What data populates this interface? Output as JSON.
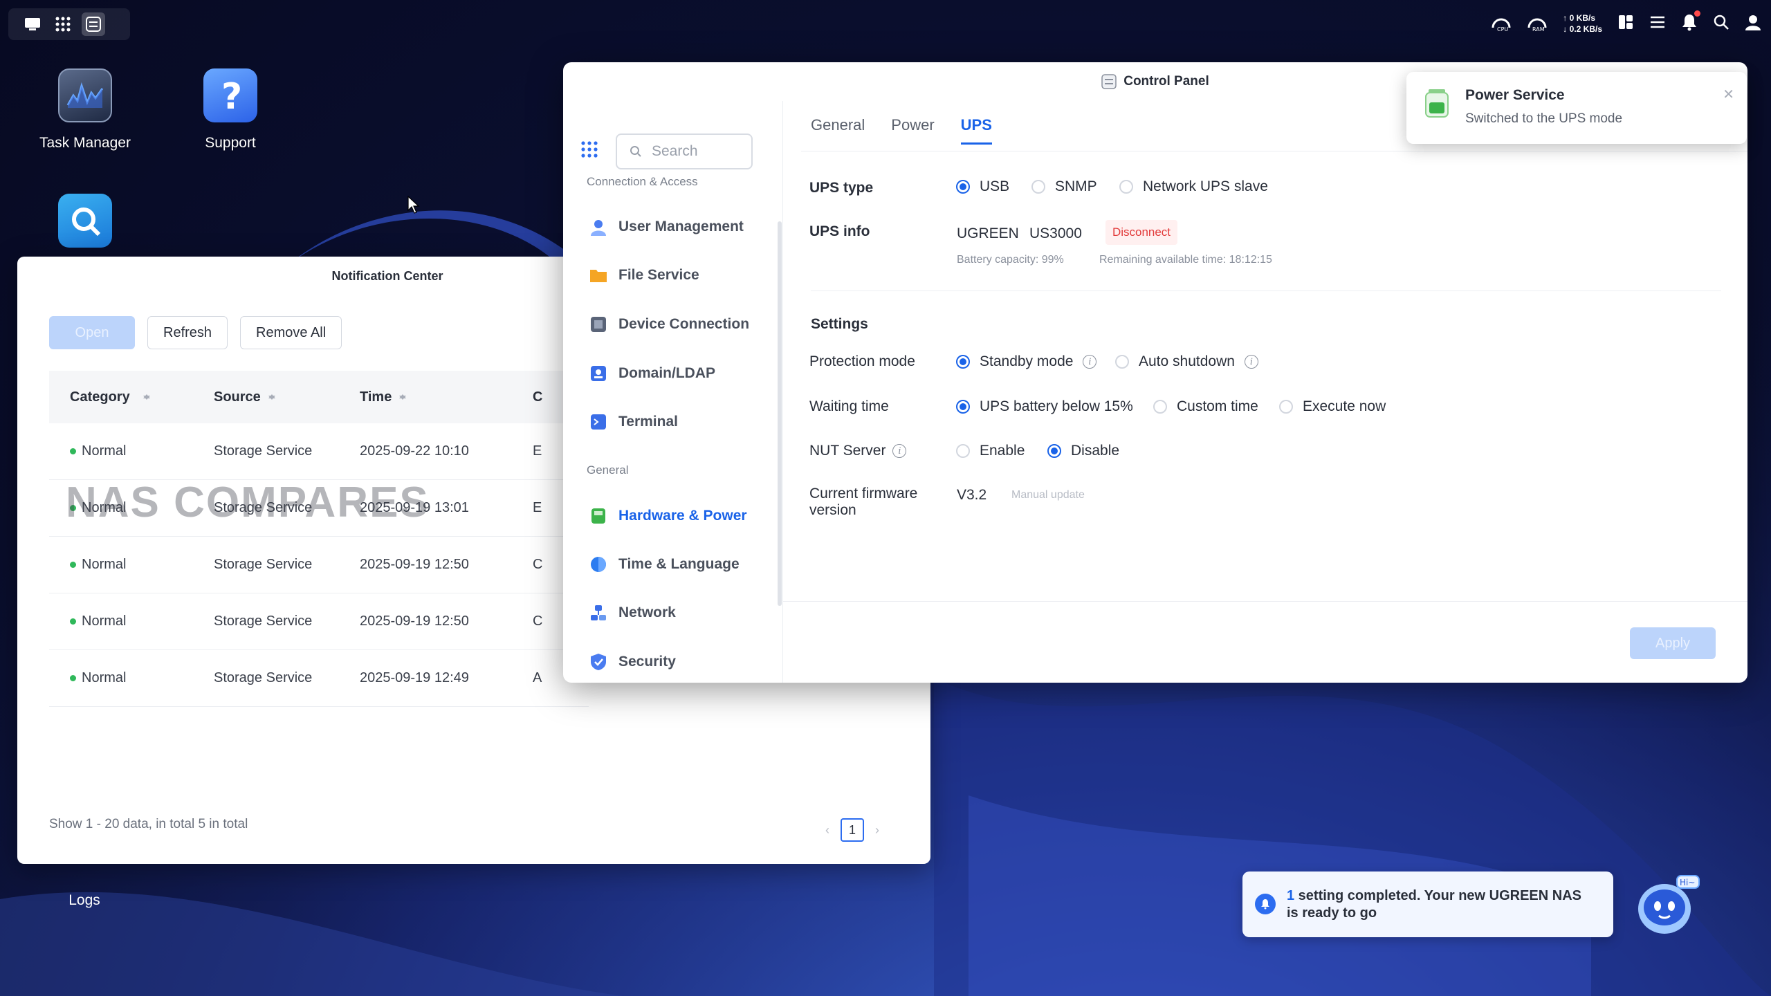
{
  "desktop": {
    "icons": [
      {
        "label": "Task Manager"
      },
      {
        "label": "Support"
      },
      {
        "label": "Logs"
      }
    ]
  },
  "topbar": {
    "net_up": "0 KB/s",
    "net_down": "0.2 KB/s",
    "icons": [
      "cpu-gauge-icon",
      "ram-gauge-icon",
      "widgets-icon",
      "task-list-icon",
      "bell-icon",
      "search-icon",
      "user-icon"
    ]
  },
  "notification_center": {
    "title": "Notification Center",
    "toolbar": {
      "open_label": "Open",
      "refresh_label": "Refresh",
      "remove_all_label": "Remove All"
    },
    "columns": [
      "Category",
      "Source",
      "Time",
      "C"
    ],
    "rows": [
      {
        "category": "Normal",
        "source": "Storage Service",
        "time": "2025-09-22 10:10",
        "content": "E"
      },
      {
        "category": "Normal",
        "source": "Storage Service",
        "time": "2025-09-19 13:01",
        "content": "E"
      },
      {
        "category": "Normal",
        "source": "Storage Service",
        "time": "2025-09-19 12:50",
        "content": "C"
      },
      {
        "category": "Normal",
        "source": "Storage Service",
        "time": "2025-09-19 12:50",
        "content": "C"
      },
      {
        "category": "Normal",
        "source": "Storage Service",
        "time": "2025-09-19 12:49",
        "content": "A"
      }
    ],
    "footer": "Show 1 - 20 data, in total 5 in total",
    "current_page": "1",
    "watermark": "NAS COMPARES"
  },
  "control_panel": {
    "title": "Control Panel",
    "search_placeholder": "Search",
    "groups": {
      "connection": "Connection & Access",
      "general": "General"
    },
    "sidebar": [
      {
        "label": "User Management",
        "color": "#4a7cf0"
      },
      {
        "label": "File Service",
        "color": "#f5a524"
      },
      {
        "label": "Device Connection",
        "color": "#5a6478"
      },
      {
        "label": "Domain/LDAP",
        "color": "#3a6ee8"
      },
      {
        "label": "Terminal",
        "color": "#3a6ee8"
      },
      {
        "label": "Hardware & Power",
        "color": "#3cb34a"
      },
      {
        "label": "Time & Language",
        "color": "#2c7cf0"
      },
      {
        "label": "Network",
        "color": "#3a6ee8"
      },
      {
        "label": "Security",
        "color": "#4a7cf0"
      }
    ],
    "tabs": [
      "General",
      "Power",
      "UPS"
    ],
    "active_tab": "UPS",
    "ups": {
      "type_label": "UPS type",
      "type_options": [
        "USB",
        "SNMP",
        "Network UPS slave"
      ],
      "type_selected": "USB",
      "info_label": "UPS info",
      "brand": "UGREEN",
      "model": "US3000",
      "disconnect_label": "Disconnect",
      "battery_capacity": "Battery capacity: 99%",
      "remaining_time": "Remaining available time: 18:12:15"
    },
    "settings": {
      "heading": "Settings",
      "protection_label": "Protection mode",
      "protection_options": [
        "Standby mode",
        "Auto shutdown"
      ],
      "protection_selected": "Standby mode",
      "waiting_label": "Waiting time",
      "waiting_options": [
        "UPS battery below 15%",
        "Custom time",
        "Execute now"
      ],
      "waiting_selected": "UPS battery below 15%",
      "nut_label": "NUT Server",
      "nut_options": [
        "Enable",
        "Disable"
      ],
      "nut_selected": "Disable",
      "firmware_label_1": "Current firmware",
      "firmware_label_2": "version",
      "firmware_version": "V3.2",
      "manual_update_label": "Manual update"
    },
    "apply_label": "Apply"
  },
  "toast": {
    "title": "Power Service",
    "message": "Switched to the UPS mode"
  },
  "assistant": {
    "count": "1",
    "line1_rest": " setting completed. Your new UGREEN NAS",
    "line2": "is ready to go",
    "badge": "Hi~"
  },
  "colors": {
    "accent": "#1a63e8",
    "danger": "#e23a3a",
    "ok": "#2fb85a"
  }
}
